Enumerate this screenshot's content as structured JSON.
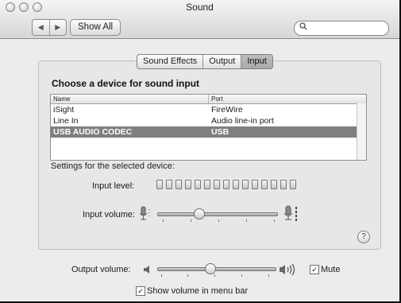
{
  "window": {
    "title": "Sound"
  },
  "toolbar": {
    "back_glyph": "◀",
    "forward_glyph": "▶",
    "show_all_label": "Show All",
    "search_placeholder": "",
    "search_icon": "magnifier-icon"
  },
  "tabs": [
    {
      "label": "Sound Effects",
      "active": false
    },
    {
      "label": "Output",
      "active": false
    },
    {
      "label": "Input",
      "active": true
    }
  ],
  "device_section": {
    "title": "Choose a device for sound input",
    "columns": {
      "name": "Name",
      "port": "Port"
    },
    "rows": [
      {
        "name": "iSight",
        "port": "FireWire",
        "selected": false
      },
      {
        "name": "Line In",
        "port": "Audio line-in port",
        "selected": false
      },
      {
        "name": "USB AUDIO CODEC",
        "port": "USB",
        "selected": true
      }
    ]
  },
  "settings": {
    "label": "Settings for the selected device:",
    "input_level_label": "Input level:",
    "input_level_segments": 15,
    "input_level_lit": 0,
    "input_volume_label": "Input volume:",
    "input_volume_fraction": 0.35
  },
  "help_glyph": "?",
  "output": {
    "volume_label": "Output volume:",
    "volume_fraction": 0.45,
    "mute_label": "Mute",
    "mute_checked": true,
    "menu_bar_label": "Show volume in menu bar",
    "menu_bar_checked": true,
    "check_glyph": "✓"
  },
  "colors": {
    "selected_row": "#7f7f7f",
    "window_bg": "#ececec"
  }
}
